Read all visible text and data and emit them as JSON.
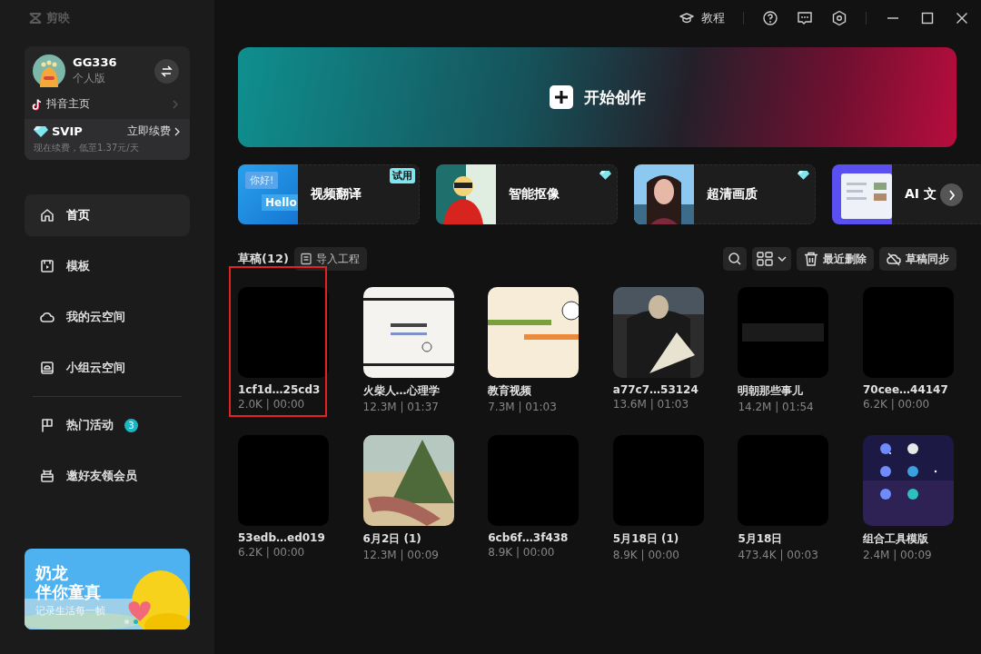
{
  "app": {
    "name": "剪映"
  },
  "title_bar": {
    "tutorial": "教程"
  },
  "account": {
    "username": "GG336",
    "plan": "个人版",
    "douyin_link": "抖音主页",
    "vip": {
      "tier": "SVIP",
      "renew": "立即续费",
      "note": "现在续费，低至1.37元/天"
    }
  },
  "nav": [
    {
      "label": "首页",
      "selected": true
    },
    {
      "label": "模板",
      "selected": false
    },
    {
      "label": "我的云空间",
      "selected": false
    },
    {
      "label": "小组云空间",
      "selected": false
    }
  ],
  "nav_extra": [
    {
      "label": "热门活动",
      "selected": false,
      "badge": "3"
    },
    {
      "label": "邀好友领会员",
      "selected": false
    }
  ],
  "banner": {
    "title": [
      "奶龙",
      "伴你童真"
    ],
    "subtitle": "记录生活每一帧",
    "dots": [
      {
        "selected": false
      },
      {
        "selected": true
      }
    ]
  },
  "create_button": {
    "label": "开始创作"
  },
  "tools": [
    {
      "label": "视频翻译",
      "art_texts": [
        "你好!",
        "Hello"
      ],
      "tag": {
        "kind": "text",
        "text": "试用"
      }
    },
    {
      "label": "智能抠像",
      "tag": {
        "kind": "vip"
      }
    },
    {
      "label": "超清画质",
      "tag": {
        "kind": "vip"
      }
    },
    {
      "label": "AI 文"
    }
  ],
  "drafts": {
    "title": "草稿(12)",
    "import": "导入工程",
    "recent_deleted": "最近删除",
    "sync": "草稿同步",
    "items": [
      {
        "title": "1cf1d…25cd3",
        "meta": "2.0K | 00:00",
        "highlighted": true
      },
      {
        "title": "火柴人…心理学",
        "meta": "12.3M | 01:37",
        "kind": "picture"
      },
      {
        "title": "教育视频",
        "meta": "7.3M | 01:03",
        "kind": "picture"
      },
      {
        "title": "a77c7…53124",
        "meta": "13.6M | 01:03",
        "kind": "picture"
      },
      {
        "title": "明朝那些事儿",
        "meta": "14.2M | 01:54",
        "kind": "picture"
      },
      {
        "title": "70cee…44147",
        "meta": "6.2K | 00:00"
      },
      {
        "title": "53edb…ed019",
        "meta": "6.2K | 00:00"
      },
      {
        "title": "6月2日 (1)",
        "meta": "12.3M | 00:09",
        "kind": "picture"
      },
      {
        "title": "6cb6f…3f438",
        "meta": "8.9K | 00:00"
      },
      {
        "title": "5月18日 (1)",
        "meta": "8.9K | 00:00"
      },
      {
        "title": "5月18日",
        "meta": "473.4K | 00:03"
      },
      {
        "title": "组合工具模版",
        "meta": "2.4M | 00:09",
        "kind": "picture"
      }
    ]
  }
}
